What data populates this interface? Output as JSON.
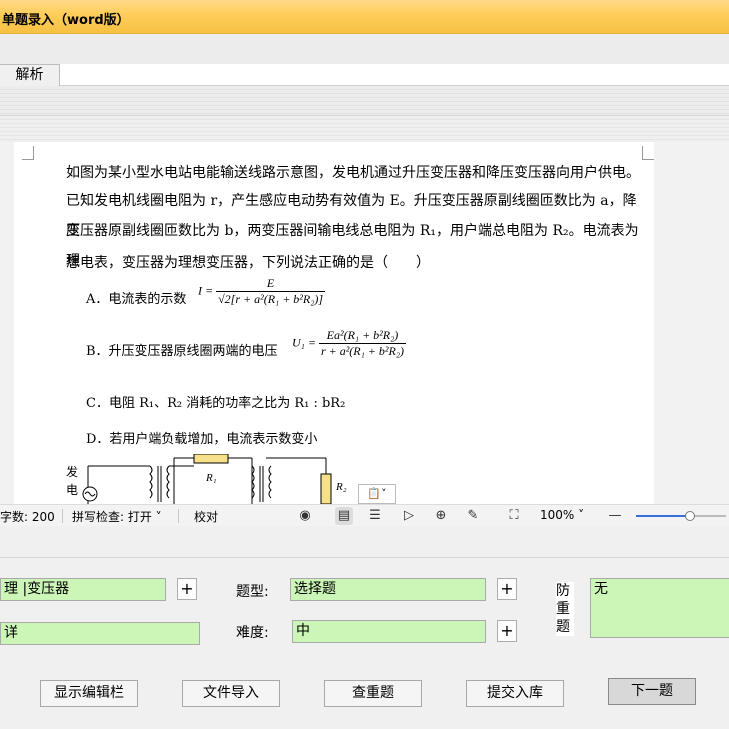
{
  "window": {
    "title": "单题录入（word版）"
  },
  "tabs": [
    {
      "label": "解析"
    }
  ],
  "question": {
    "stem_lines": [
      "如图为某小型水电站电能输送线路示意图，发电机通过升压变压器和降压变压器向用户供电。",
      "已知发电机线圈电阻为 r，产生感应电动势有效值为 E。升压变压器原副线圈匝数比为 a，降压",
      "变压器原副线圈匝数比为 b，两变压器间输电线总电阻为 R₁，用户端总电阻为 R₂。电流表为理",
      "想电表，变压器为理想变压器，下列说法正确的是（　　）"
    ],
    "options": {
      "a_text": "A．电流表的示数",
      "a_formula_lhs": "I =",
      "a_formula_num": "E",
      "a_formula_den": "√2[r + a²(R₁ + b²R₂)]",
      "b_text": "B．升压变压器原线圈两端的电压",
      "b_formula_lhs": "U₁ =",
      "b_formula_num": "Ea²(R₁ + b²R₂)",
      "b_formula_den": "r + a²(R₁ + b²R₂)",
      "c_text": "C．电阻 R₁、R₂ 消耗的功率之比为 R₁ : bR₂",
      "d_text": "D．若用户端负载增加，电流表示数变小"
    },
    "figure": {
      "generator_label_1": "发",
      "generator_label_2": "电",
      "r1_label": "R₁",
      "r2_label": "R₂"
    }
  },
  "statusbar": {
    "word_count": "字数: 200",
    "spellcheck": "拼写检查: 打开",
    "proofread": "校对",
    "zoom": "100%",
    "zoom_level": 0.6
  },
  "form": {
    "knowledge_value": "理 |变压器",
    "second_value": "详",
    "type_label": "题型:",
    "type_value": "选择题",
    "difficulty_label": "难度:",
    "difficulty_value": "中",
    "dup_label": "防重题",
    "dup_value": "无",
    "plus": "+"
  },
  "buttons": {
    "show_toolbar": "显示编辑栏",
    "import_file": "文件导入",
    "check_dup": "查重题",
    "submit": "提交入库",
    "next": "下一题"
  },
  "colors": {
    "accent": "#ffcf5c",
    "field_bg": "#ccf5b8",
    "zoom_fill": "#3b6fd8"
  }
}
